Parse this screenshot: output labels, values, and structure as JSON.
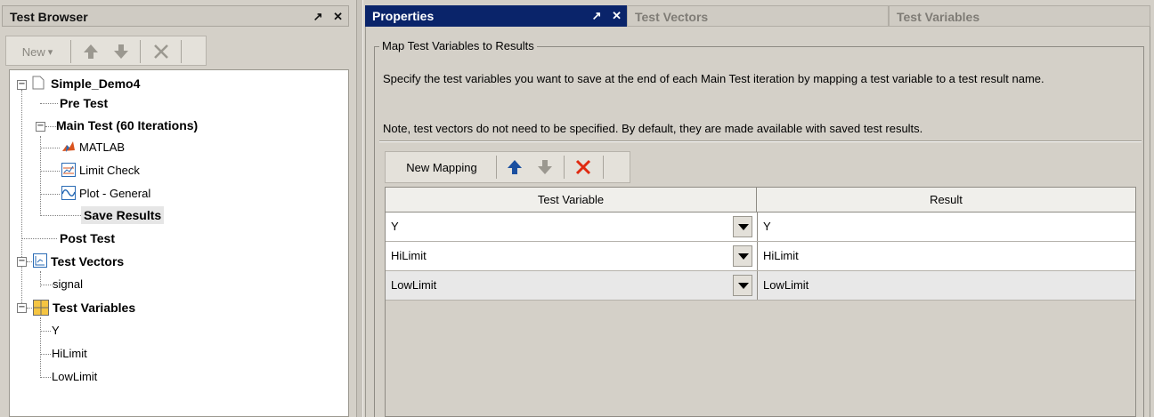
{
  "left_panel": {
    "title": "Test Browser",
    "controls": {
      "undock": "↗",
      "close": "✕"
    },
    "toolbar": {
      "new_label": "New",
      "new_arrow": "▾"
    },
    "tree": {
      "root": "Simple_Demo4",
      "pre_test": "Pre Test",
      "main_test": "Main Test (60 Iterations)",
      "main_children": [
        "MATLAB",
        "Limit Check",
        "Plot - General",
        "Save Results"
      ],
      "post_test": "Post Test",
      "test_vectors": "Test Vectors",
      "vector_children": [
        "signal"
      ],
      "test_variables": "Test Variables",
      "variable_children": [
        "Y",
        "HiLimit",
        "LowLimit"
      ]
    }
  },
  "tabs": [
    {
      "label": "Properties",
      "active": true
    },
    {
      "label": "Test Vectors",
      "active": false
    },
    {
      "label": "Test Variables",
      "active": false
    }
  ],
  "properties": {
    "group_title": "Map Test Variables to Results",
    "description": "Specify the test variables you want to save at the end of each Main Test iteration by mapping a test variable to a test result name.",
    "note": "Note, test vectors do not need to be specified. By default, they are made available with saved test results.",
    "toolbar": {
      "new_mapping_label": "New Mapping"
    },
    "table": {
      "columns": [
        "Test Variable",
        "Result"
      ],
      "rows": [
        {
          "variable": "Y",
          "result": "Y"
        },
        {
          "variable": "HiLimit",
          "result": "HiLimit"
        },
        {
          "variable": "LowLimit",
          "result": "LowLimit"
        }
      ]
    }
  },
  "colors": {
    "active_tab": "#0a246a",
    "up_arrow_active": "#1a4fa0",
    "arrow_disabled": "#9b9890",
    "delete_red": "#e02a10"
  }
}
